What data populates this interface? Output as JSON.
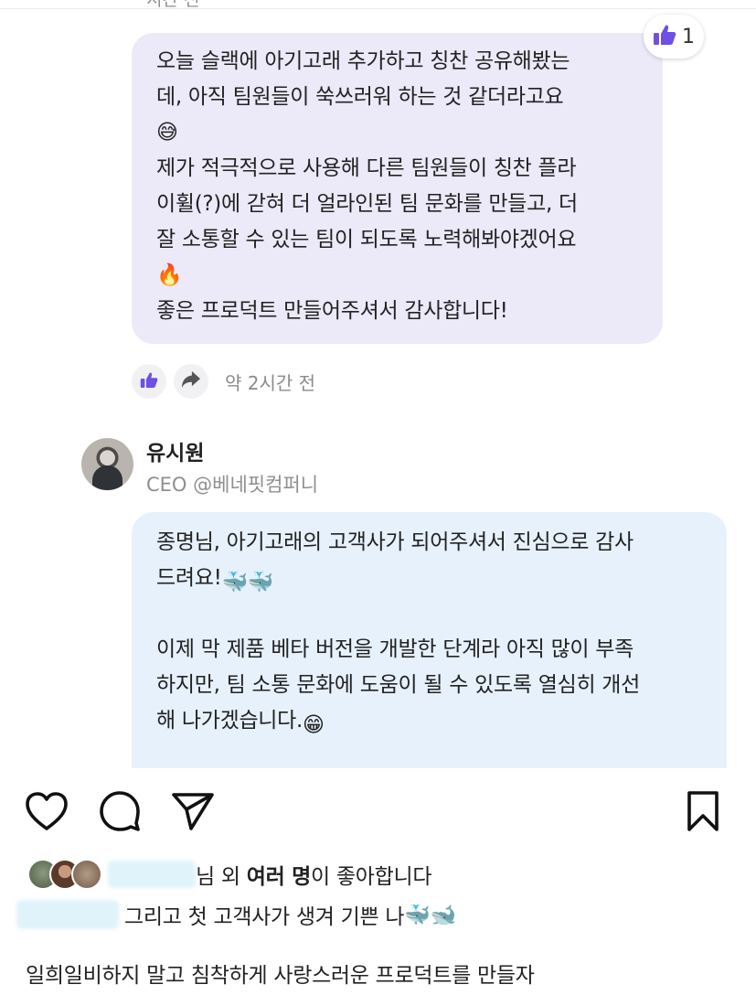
{
  "top_fragment": "시간 전",
  "comment": {
    "lines": [
      "오늘 슬랙에 아기고래 추가하고 칭찬 공유해봤는",
      "데, 아직 팀원들이 쑥쓰러워 하는 것 같더라고요",
      "😅",
      "제가 적극적으로 사용해 다른 팀원들이 칭찬 플라",
      "이휠(?)에 갇혀 더 얼라인된 팀 문화를 만들고, 더",
      "잘 소통할 수 있는 팀이 되도록 노력해봐야겠어요",
      "🔥",
      "좋은 프로덕트 만들어주셔서 감사합니다!"
    ],
    "like_count": "1",
    "time_ago": "약 2시간 전"
  },
  "reply": {
    "author_name": "유시원",
    "author_title": "CEO @베네핏컴퍼니",
    "line1": "종명님, 아기고래의 고객사가 되어주셔서 진심으로 감사",
    "line2_text": "드려요!",
    "line2_emoji": "🐳🐳",
    "line3": "이제 막 제품 베타 버전을 개발한 단계라 아직 많이 부족",
    "line4": "하지만, 팀 소통 문화에 도움이 될 수 있도록 열심히 개선",
    "line5_text": "해 나가겠습니다.",
    "line5_emoji": "😁"
  },
  "post": {
    "likes_suffix": "님 외 ",
    "likes_bold": "여러 명",
    "likes_tail": "이 좋아합니다",
    "caption_text": "그리고 첫 고객사가 생겨 기쁜 나",
    "caption_emoji": "🐳🐋",
    "caption_line2": "일희일비하지 말고 침착하게 사랑스러운 프로덕트를 만들자"
  },
  "icons": [
    "thumbs-up-icon",
    "share-arrow-icon",
    "heart-icon",
    "comment-icon",
    "send-icon",
    "bookmark-icon"
  ],
  "colors": {
    "comment_bubble": "#ece9f9",
    "reply_bubble": "#e6f1fc",
    "accent_purple": "#6f4fe6"
  }
}
